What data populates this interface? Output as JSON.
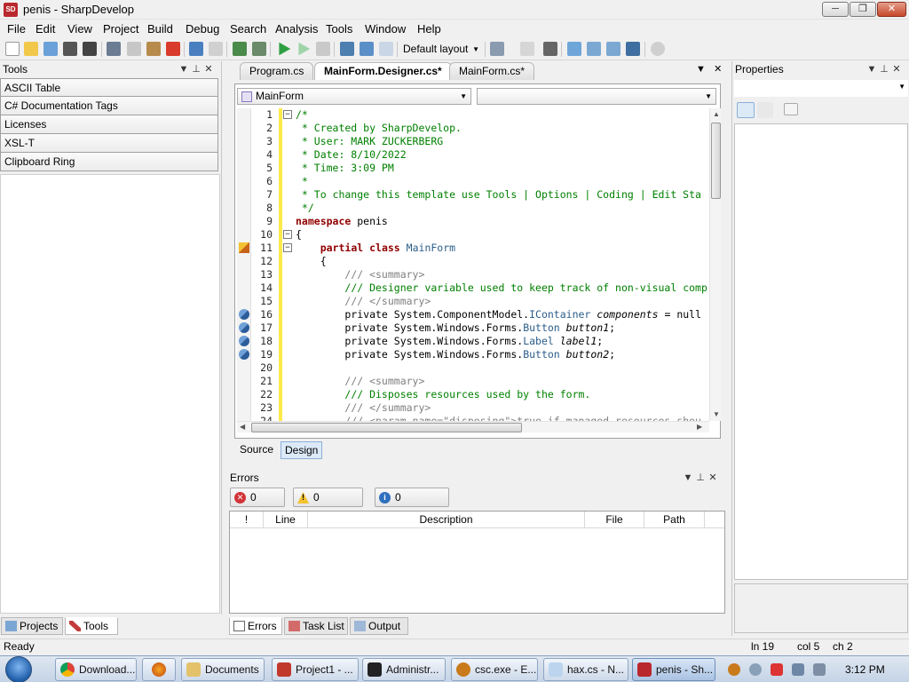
{
  "window": {
    "title": "penis - SharpDevelop",
    "min_glyph": "─",
    "max_glyph": "❐",
    "close_glyph": "✕"
  },
  "menu": [
    "File",
    "Edit",
    "View",
    "Project",
    "Build",
    "Debug",
    "Search",
    "Analysis",
    "Tools",
    "Window",
    "Help"
  ],
  "toolbar": {
    "layout_dropdown": "Default layout"
  },
  "tools_panel": {
    "title": "Tools",
    "items": [
      "ASCII Table",
      "C# Documentation Tags",
      "Licenses",
      "XSL-T",
      "Clipboard Ring"
    ],
    "bottom_tabs": [
      "Projects",
      "Tools"
    ]
  },
  "editor": {
    "tabs": [
      "Program.cs",
      "MainForm.Designer.cs*",
      "MainForm.cs*"
    ],
    "class_combo": "MainForm",
    "member_combo": "",
    "view_tabs": [
      "Source",
      "Design"
    ],
    "lines": [
      {
        "n": "1",
        "fold": "−",
        "segs": [
          [
            "c-comment",
            "/*"
          ]
        ]
      },
      {
        "n": "2",
        "segs": [
          [
            "c-comment",
            " * Created by SharpDevelop."
          ]
        ]
      },
      {
        "n": "3",
        "segs": [
          [
            "c-comment",
            " * User: MARK ZUCKERBERG"
          ]
        ]
      },
      {
        "n": "4",
        "segs": [
          [
            "c-comment",
            " * Date: 8/10/2022"
          ]
        ]
      },
      {
        "n": "5",
        "segs": [
          [
            "c-comment",
            " * Time: 3:09 PM"
          ]
        ]
      },
      {
        "n": "6",
        "segs": [
          [
            "c-comment",
            " *"
          ]
        ]
      },
      {
        "n": "7",
        "segs": [
          [
            "c-comment",
            " * To change this template use Tools | Options | Coding | Edit Sta"
          ]
        ]
      },
      {
        "n": "8",
        "segs": [
          [
            "c-comment",
            " */"
          ]
        ]
      },
      {
        "n": "9",
        "segs": [
          [
            "c-kw",
            "namespace"
          ],
          [
            "c-plain",
            " penis"
          ]
        ]
      },
      {
        "n": "10",
        "fold": "−",
        "segs": [
          [
            "c-plain",
            "{"
          ]
        ]
      },
      {
        "n": "11",
        "fold": "−",
        "marker": "class",
        "segs": [
          [
            "c-plain",
            "    "
          ],
          [
            "c-kw",
            "partial"
          ],
          [
            "c-plain",
            " "
          ],
          [
            "c-kw",
            "class"
          ],
          [
            "c-plain",
            " "
          ],
          [
            "c-type",
            "MainForm"
          ]
        ]
      },
      {
        "n": "12",
        "segs": [
          [
            "c-plain",
            "    {"
          ]
        ]
      },
      {
        "n": "13",
        "segs": [
          [
            "c-plain",
            "        "
          ],
          [
            "c-gray",
            "/// <summary>"
          ]
        ]
      },
      {
        "n": "14",
        "segs": [
          [
            "c-plain",
            "        "
          ],
          [
            "c-comment",
            "/// Designer variable used to keep track of non-visual comp"
          ]
        ]
      },
      {
        "n": "15",
        "segs": [
          [
            "c-plain",
            "        "
          ],
          [
            "c-gray",
            "/// </summary>"
          ]
        ]
      },
      {
        "n": "16",
        "marker": "field",
        "segs": [
          [
            "c-plain",
            "        private System.ComponentModel."
          ],
          [
            "c-type",
            "IContainer"
          ],
          [
            "c-plain",
            " "
          ],
          [
            "c-plain c-ital",
            "components"
          ],
          [
            "c-plain",
            " = null"
          ]
        ]
      },
      {
        "n": "17",
        "marker": "field",
        "segs": [
          [
            "c-plain",
            "        private System.Windows.Forms."
          ],
          [
            "c-type",
            "Button"
          ],
          [
            "c-plain",
            " "
          ],
          [
            "c-plain c-ital",
            "button1"
          ],
          [
            "c-plain",
            ";"
          ]
        ]
      },
      {
        "n": "18",
        "marker": "field",
        "segs": [
          [
            "c-plain",
            "        private System.Windows.Forms."
          ],
          [
            "c-type",
            "Label"
          ],
          [
            "c-plain",
            " "
          ],
          [
            "c-plain c-ital",
            "label1"
          ],
          [
            "c-plain",
            ";"
          ]
        ]
      },
      {
        "n": "19",
        "marker": "field",
        "segs": [
          [
            "c-plain",
            "        private System.Windows.Forms."
          ],
          [
            "c-type",
            "Button"
          ],
          [
            "c-plain",
            " "
          ],
          [
            "c-plain c-ital",
            "button2"
          ],
          [
            "c-plain",
            ";"
          ]
        ]
      },
      {
        "n": "20",
        "segs": [
          [
            "c-plain",
            ""
          ]
        ]
      },
      {
        "n": "21",
        "segs": [
          [
            "c-plain",
            "        "
          ],
          [
            "c-gray",
            "/// <summary>"
          ]
        ]
      },
      {
        "n": "22",
        "segs": [
          [
            "c-plain",
            "        "
          ],
          [
            "c-comment",
            "/// Disposes resources used by the form."
          ]
        ]
      },
      {
        "n": "23",
        "segs": [
          [
            "c-plain",
            "        "
          ],
          [
            "c-gray",
            "/// </summary>"
          ]
        ]
      },
      {
        "n": "24",
        "segs": [
          [
            "c-plain",
            "        "
          ],
          [
            "c-gray",
            "/// <param name=\"disposing\">true if managed resources shou"
          ]
        ]
      }
    ]
  },
  "errors_panel": {
    "title": "Errors",
    "buttons": [
      "0 Errors",
      "0 Warnings",
      "0 Messages"
    ],
    "columns": [
      "!",
      "Line",
      "Description",
      "File",
      "Path"
    ],
    "bottom_tabs": [
      "Errors",
      "Task List",
      "Output"
    ]
  },
  "properties_panel": {
    "title": "Properties",
    "combo_value": ""
  },
  "statusbar": {
    "status": "Ready",
    "line": "ln 19",
    "col": "col 5",
    "ch": "ch 2"
  },
  "taskbar": {
    "buttons": [
      "Download...",
      "",
      "Documents",
      "Project1 - ...",
      "Administr...",
      "csc.exe - E...",
      "hax.cs - N...",
      "penis - Sh..."
    ],
    "clock": "3:12 PM"
  },
  "colors": {
    "accent_yellow": "#ffe94a",
    "keyword": "#900000",
    "comment": "#008000",
    "type": "#2b5d8a"
  }
}
